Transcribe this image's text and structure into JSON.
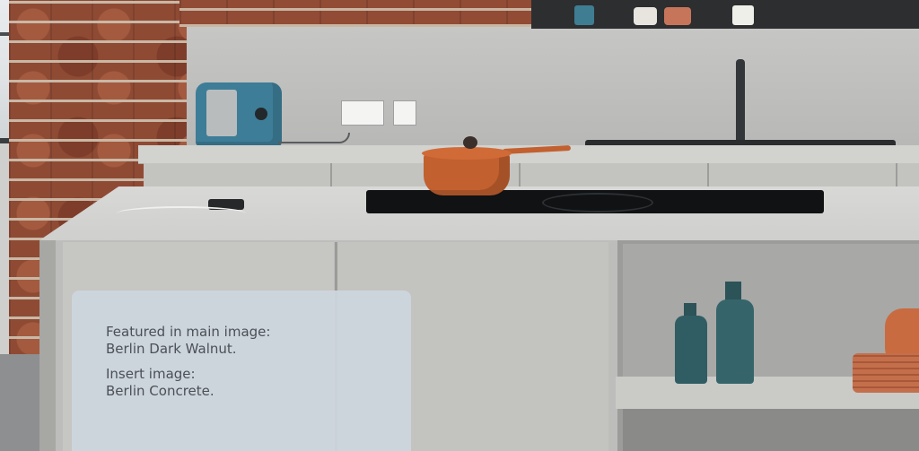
{
  "caption": {
    "line1": "Featured in main image:",
    "line2": "Berlin Dark Walnut.",
    "line3": "Insert image:",
    "line4": "Berlin Concrete."
  },
  "colors": {
    "caption_background": "#ced6de",
    "caption_text": "#4b5056",
    "brick": "#8f4a34",
    "concrete": "#c6c6c4",
    "cookware": "#c2602f",
    "toaster": "#3d7d97",
    "glass_bottles": "#2f5d63"
  }
}
